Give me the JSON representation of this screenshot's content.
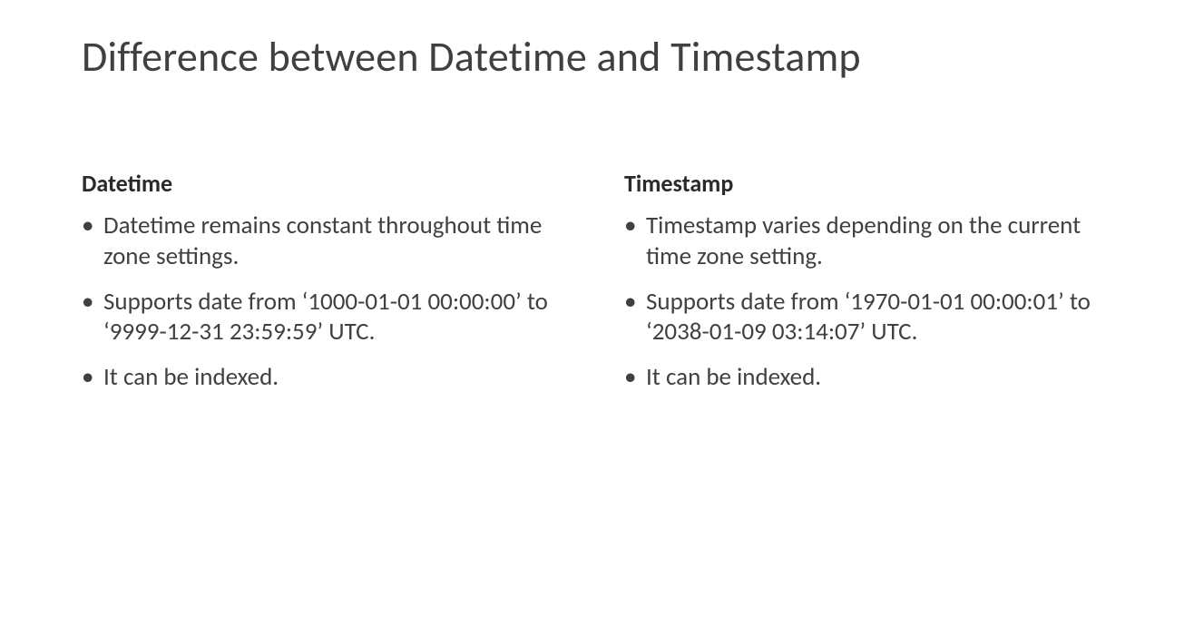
{
  "title": "Difference between Datetime and Timestamp",
  "left": {
    "heading": "Datetime",
    "bullets": [
      "Datetime remains constant throughout time zone settings.",
      "Supports date from ‘1000-01-01 00:00:00’ to ‘9999-12-31 23:59:59’ UTC.",
      "It can be indexed."
    ]
  },
  "right": {
    "heading": "Timestamp",
    "bullets": [
      "Timestamp varies depending on the current time zone setting.",
      "Supports date from ‘1970-01-01 00:00:01’ to ‘2038-01-09 03:14:07’ UTC.",
      "It can be indexed."
    ]
  }
}
